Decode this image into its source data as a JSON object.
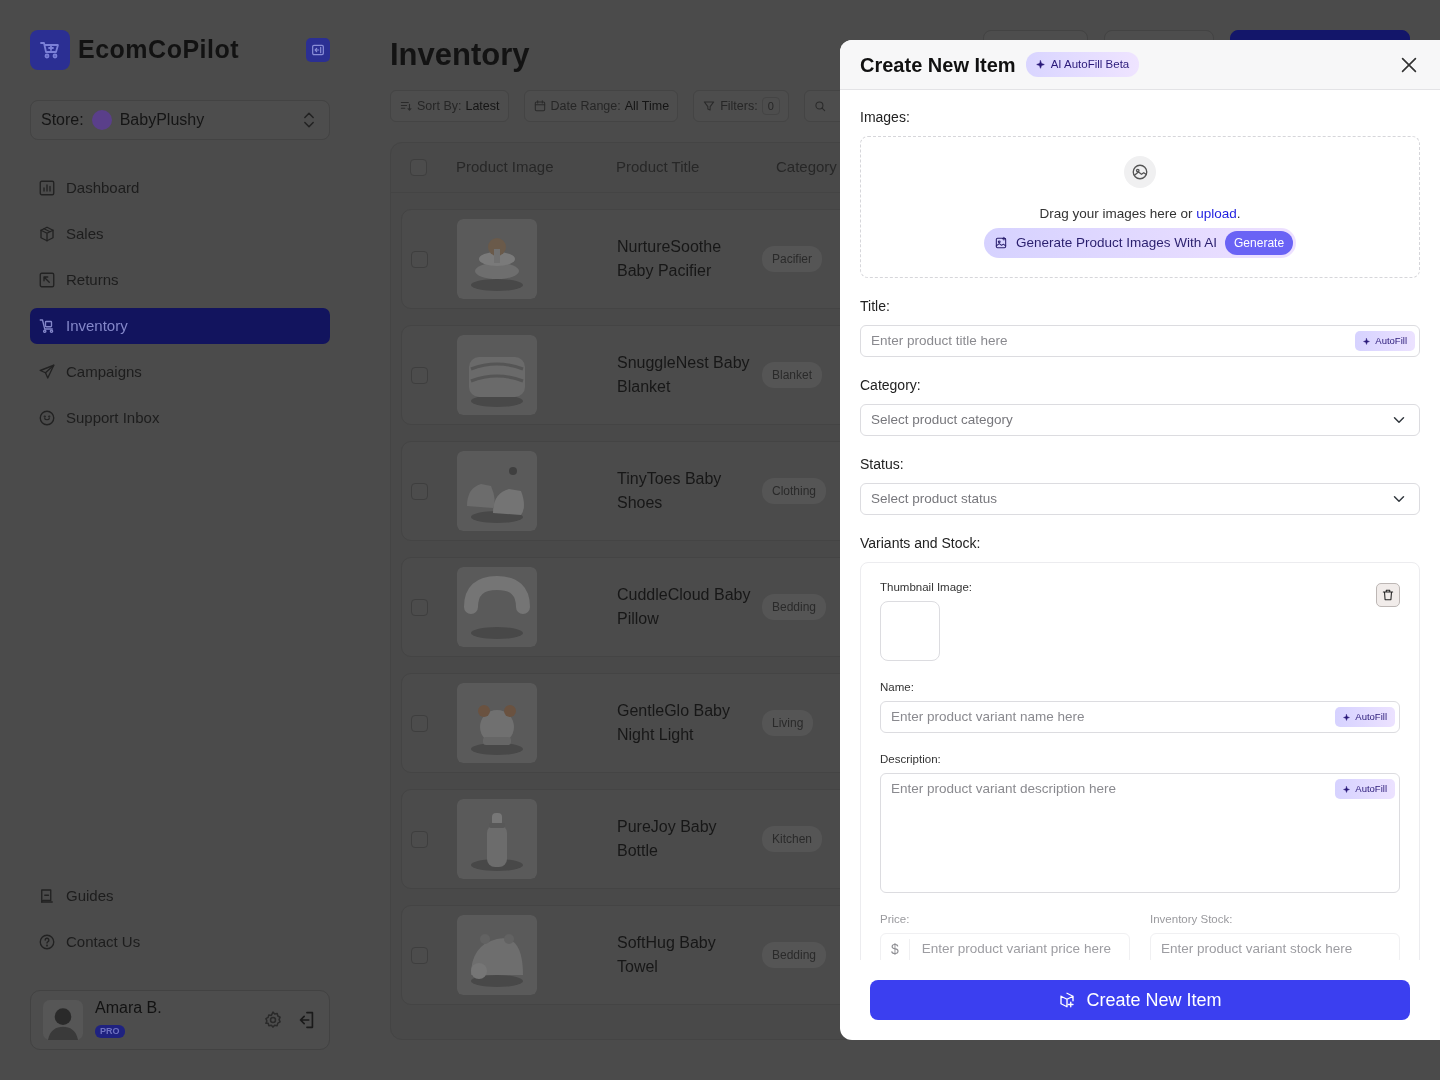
{
  "sidebar": {
    "brand": "EcomCoPilot",
    "store": {
      "label": "Store:",
      "value": "BabyPlushy"
    },
    "nav": [
      {
        "label": "Dashboard",
        "selected": false
      },
      {
        "label": "Sales",
        "selected": false
      },
      {
        "label": "Returns",
        "selected": false
      },
      {
        "label": "Inventory",
        "selected": true
      },
      {
        "label": "Campaigns",
        "selected": false
      },
      {
        "label": "Support Inbox",
        "selected": false
      }
    ],
    "footer_nav": [
      {
        "label": "Guides"
      },
      {
        "label": "Contact Us"
      }
    ],
    "user": {
      "name": "Amara B.",
      "badge": "PRO"
    }
  },
  "main": {
    "title": "Inventory",
    "filters": [
      {
        "label": "Sort By:",
        "value": "Latest"
      },
      {
        "label": "Date Range:",
        "value": "All Time"
      },
      {
        "label": "Filters:",
        "value": "0"
      }
    ],
    "table": {
      "header_checked": false,
      "columns": [
        "Product Image",
        "Product Title",
        "Category"
      ],
      "rows": [
        {
          "checked": false,
          "title": "NurtureSoothe Baby Pacifier",
          "category": "Pacifier"
        },
        {
          "checked": false,
          "title": "SnuggleNest Baby Blanket",
          "category": "Blanket"
        },
        {
          "checked": false,
          "title": "TinyToes Baby Shoes",
          "category": "Clothing"
        },
        {
          "checked": false,
          "title": "CuddleCloud Baby Pillow",
          "category": "Bedding"
        },
        {
          "checked": false,
          "title": "GentleGlo Baby Night Light",
          "category": "Living"
        },
        {
          "checked": false,
          "title": "PureJoy Baby Bottle",
          "category": "Kitchen"
        },
        {
          "checked": false,
          "title": "SoftHug Baby Towel",
          "category": "Bedding"
        }
      ]
    }
  },
  "drawer": {
    "title": "Create New Item",
    "badge": "AI AutoFill Beta",
    "images": {
      "label": "Images:",
      "prompt_before": "Drag your images here or",
      "link": "upload",
      "prompt_after": ".",
      "generate_label": "Generate Product Images With AI",
      "generate_button": "Generate"
    },
    "fields": [
      {
        "kind": "text",
        "label": "Title:",
        "placeholder": "Enter product title here",
        "autofill": "AutoFill"
      },
      {
        "kind": "select",
        "label": "Category:",
        "placeholder": "Select product category"
      },
      {
        "kind": "select",
        "label": "Status:",
        "placeholder": "Select product status"
      }
    ],
    "variants": {
      "label": "Variants and Stock:",
      "thumbnail_label": "Thumbnail Image:",
      "name": {
        "label": "Name:",
        "placeholder": "Enter product variant name here",
        "autofill": "AutoFill"
      },
      "description": {
        "label": "Description:",
        "placeholder": "Enter product variant description here",
        "autofill": "AutoFill"
      },
      "price": {
        "label": "Price:",
        "prefix": "$",
        "placeholder": "Enter product variant price here"
      },
      "stock": {
        "label": "Inventory Stock:",
        "placeholder": "Enter product variant stock here"
      }
    },
    "submit": "Create New Item"
  }
}
